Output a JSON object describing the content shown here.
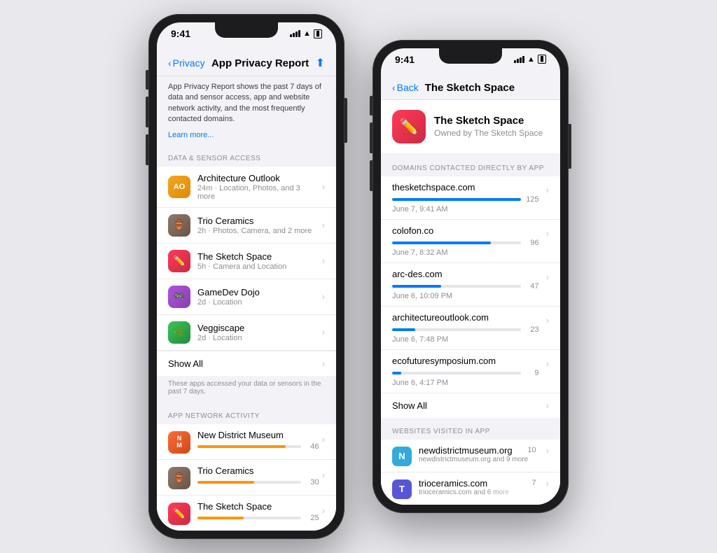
{
  "background_color": "#e8e8ed",
  "phone1": {
    "status_time": "9:41",
    "nav_back_label": "Privacy",
    "nav_title": "App Privacy Report",
    "nav_action": "share",
    "description": "App Privacy Report shows the past 7 days of data and sensor access, app and website network activity, and the most frequently contacted domains.",
    "learn_more": "Learn more...",
    "section_data_sensor": "DATA & SENSOR ACCESS",
    "apps_sensor": [
      {
        "name": "Architecture Outlook",
        "detail": "24m · Location, Photos, and 3 more",
        "icon_class": "icon-ao",
        "icon_text": "AO"
      },
      {
        "name": "Trio Ceramics",
        "detail": "2h · Photos, Camera, and 2 more",
        "icon_class": "icon-trio",
        "icon_text": "🏺"
      },
      {
        "name": "The Sketch Space",
        "detail": "5h · Camera and Location",
        "icon_class": "icon-sketch",
        "icon_text": "✏️"
      },
      {
        "name": "GameDev Dojo",
        "detail": "2d · Location",
        "icon_class": "icon-gamedev",
        "icon_text": "🎮"
      },
      {
        "name": "Veggiscape",
        "detail": "2d · Location",
        "icon_class": "icon-veggi",
        "icon_text": "🌿"
      }
    ],
    "show_all_label": "Show All",
    "footer_sensor": "These apps accessed your data or sensors in the past 7 days.",
    "section_network": "APP NETWORK ACTIVITY",
    "apps_network": [
      {
        "name": "New District Museum",
        "bar_pct": 0.85,
        "count": "46",
        "icon_class": "icon-ndm",
        "icon_text": "NM",
        "bar_color": "orange"
      },
      {
        "name": "Trio Ceramics",
        "bar_pct": 0.55,
        "count": "30",
        "icon_class": "icon-trio",
        "icon_text": "🏺",
        "bar_color": "orange"
      },
      {
        "name": "The Sketch Space",
        "bar_pct": 0.45,
        "count": "25",
        "icon_class": "icon-sketch",
        "icon_text": "✏️",
        "bar_color": "orange"
      }
    ]
  },
  "phone2": {
    "status_time": "9:41",
    "nav_back_label": "Back",
    "nav_title": "The Sketch Space",
    "app_name": "The Sketch Space",
    "app_subtitle": "Owned by The Sketch Space",
    "section_domains": "DOMAINS CONTACTED DIRECTLY BY APP",
    "domains": [
      {
        "name": "thesketchspace.com",
        "date": "June 7, 9:41 AM",
        "count": 125,
        "bar_pct": 1.0
      },
      {
        "name": "colofon.co",
        "date": "June 7, 8:32 AM",
        "count": 96,
        "bar_pct": 0.77
      },
      {
        "name": "arc-des.com",
        "date": "June 6, 10:09 PM",
        "count": 47,
        "bar_pct": 0.38
      },
      {
        "name": "architectureoutlook.com",
        "date": "June 6, 7:48 PM",
        "count": 23,
        "bar_pct": 0.18
      },
      {
        "name": "ecofuturesymposium.com",
        "date": "June 6, 4:17 PM",
        "count": 9,
        "bar_pct": 0.07
      }
    ],
    "show_all_label": "Show All",
    "section_websites": "WEBSITES VISITED IN APP",
    "websites": [
      {
        "name": "newdistrictmuseum.org",
        "count": 10,
        "sub": "newdistrictmuseum.org and 9 more",
        "icon_letter": "N",
        "icon_class": "icon-n"
      },
      {
        "name": "trioceramics.com",
        "count": 7,
        "sub": "trioceramics.com and 6 more",
        "icon_letter": "T",
        "icon_class": "icon-t"
      }
    ]
  }
}
